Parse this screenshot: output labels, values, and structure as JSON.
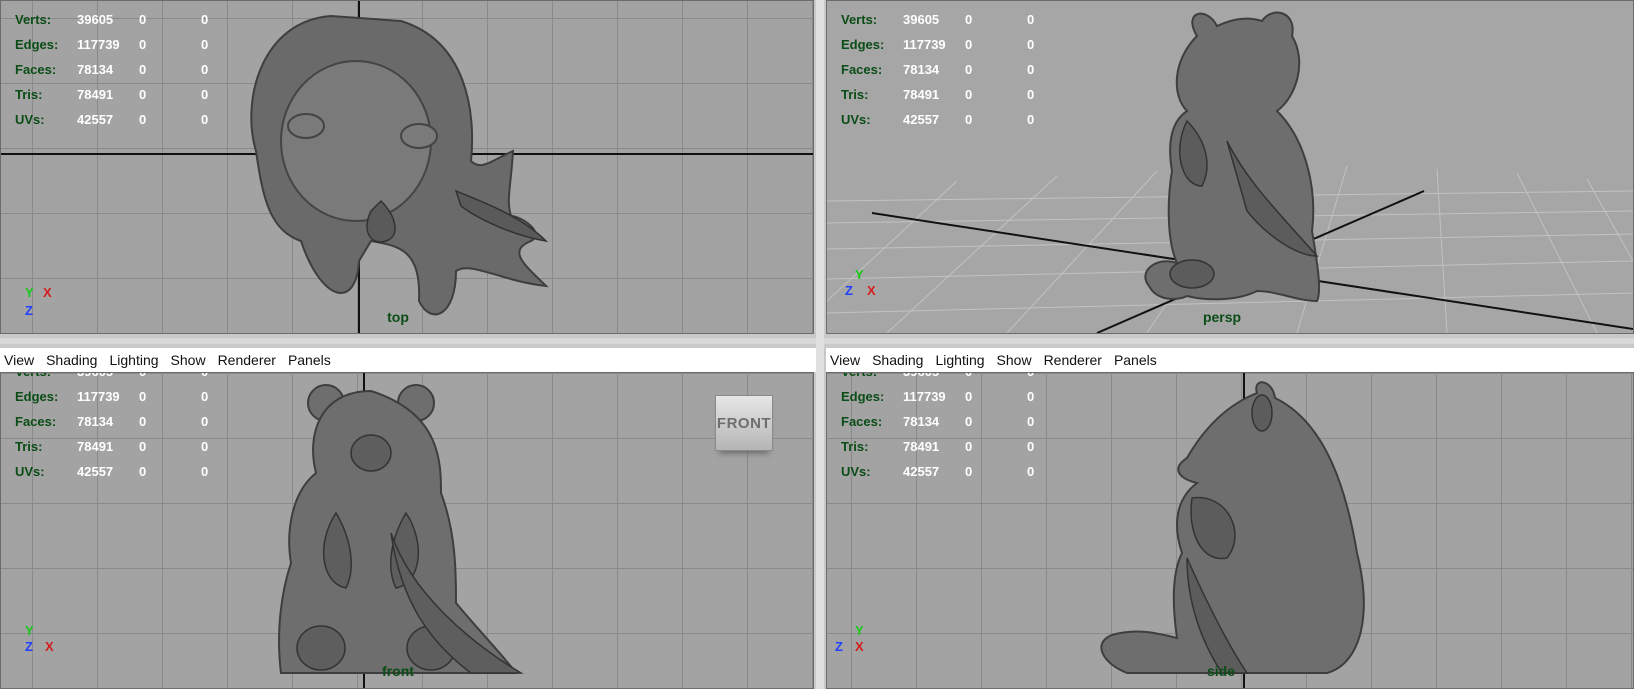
{
  "menu": {
    "view": "View",
    "shading": "Shading",
    "lighting": "Lighting",
    "show": "Show",
    "renderer": "Renderer",
    "panels": "Panels"
  },
  "hud": {
    "verts": {
      "label": "Verts:",
      "v1": "39605",
      "v2": "0",
      "v3": "0"
    },
    "edges": {
      "label": "Edges:",
      "v1": "117739",
      "v2": "0",
      "v3": "0"
    },
    "faces": {
      "label": "Faces:",
      "v1": "78134",
      "v2": "0",
      "v3": "0"
    },
    "tris": {
      "label": "Tris:",
      "v1": "78491",
      "v2": "0",
      "v3": "0"
    },
    "uvs": {
      "label": "UVs:",
      "v1": "42557",
      "v2": "0",
      "v3": "0"
    }
  },
  "viewports": {
    "top": {
      "camera": "top",
      "gizmo": [
        "Y",
        "X",
        "Z"
      ]
    },
    "persp": {
      "camera": "persp",
      "gizmo": [
        "Y",
        "Z",
        "X"
      ]
    },
    "front": {
      "camera": "front",
      "gizmo": [
        "Y",
        "Z",
        "X"
      ],
      "viewcube": "FRONT"
    },
    "side": {
      "camera": "side",
      "gizmo": [
        "Y",
        "Z",
        "X"
      ]
    }
  },
  "colors": {
    "viewport_bg": "#a3a3a3",
    "hud_label": "#0b4d16",
    "hud_value": "#ffffff",
    "model": "#6a6a6a"
  },
  "icons": [
    "axis-gizmo-icon",
    "viewcube-icon"
  ]
}
